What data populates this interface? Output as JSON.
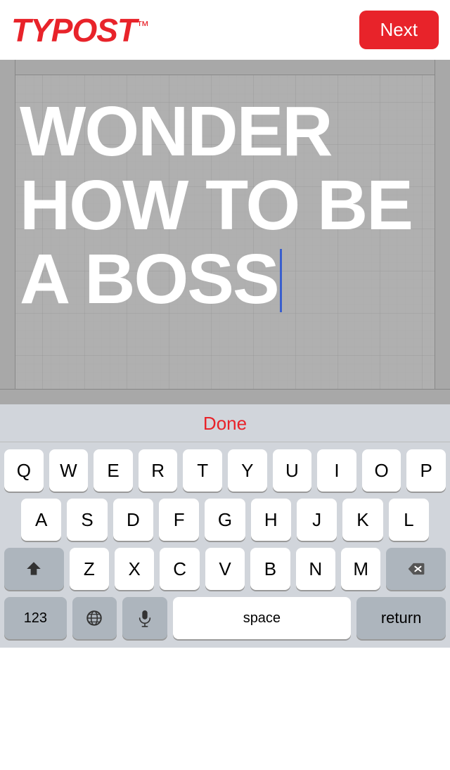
{
  "header": {
    "logo": "TYPOST",
    "logo_tm": "™",
    "next_label": "Next"
  },
  "editor": {
    "text_line1": "WONDER",
    "text_line2": "HOW TO BE",
    "text_line3": "A BOSS"
  },
  "keyboard": {
    "done_label": "Done",
    "rows": [
      [
        "Q",
        "W",
        "E",
        "R",
        "T",
        "Y",
        "U",
        "I",
        "O",
        "P"
      ],
      [
        "A",
        "S",
        "D",
        "F",
        "G",
        "H",
        "J",
        "K",
        "L"
      ],
      [
        "Z",
        "X",
        "C",
        "V",
        "B",
        "N",
        "M"
      ],
      [
        "123",
        "🌐",
        "🎤",
        "space",
        "return"
      ]
    ],
    "space_label": "space",
    "return_label": "return",
    "num_label": "123"
  }
}
